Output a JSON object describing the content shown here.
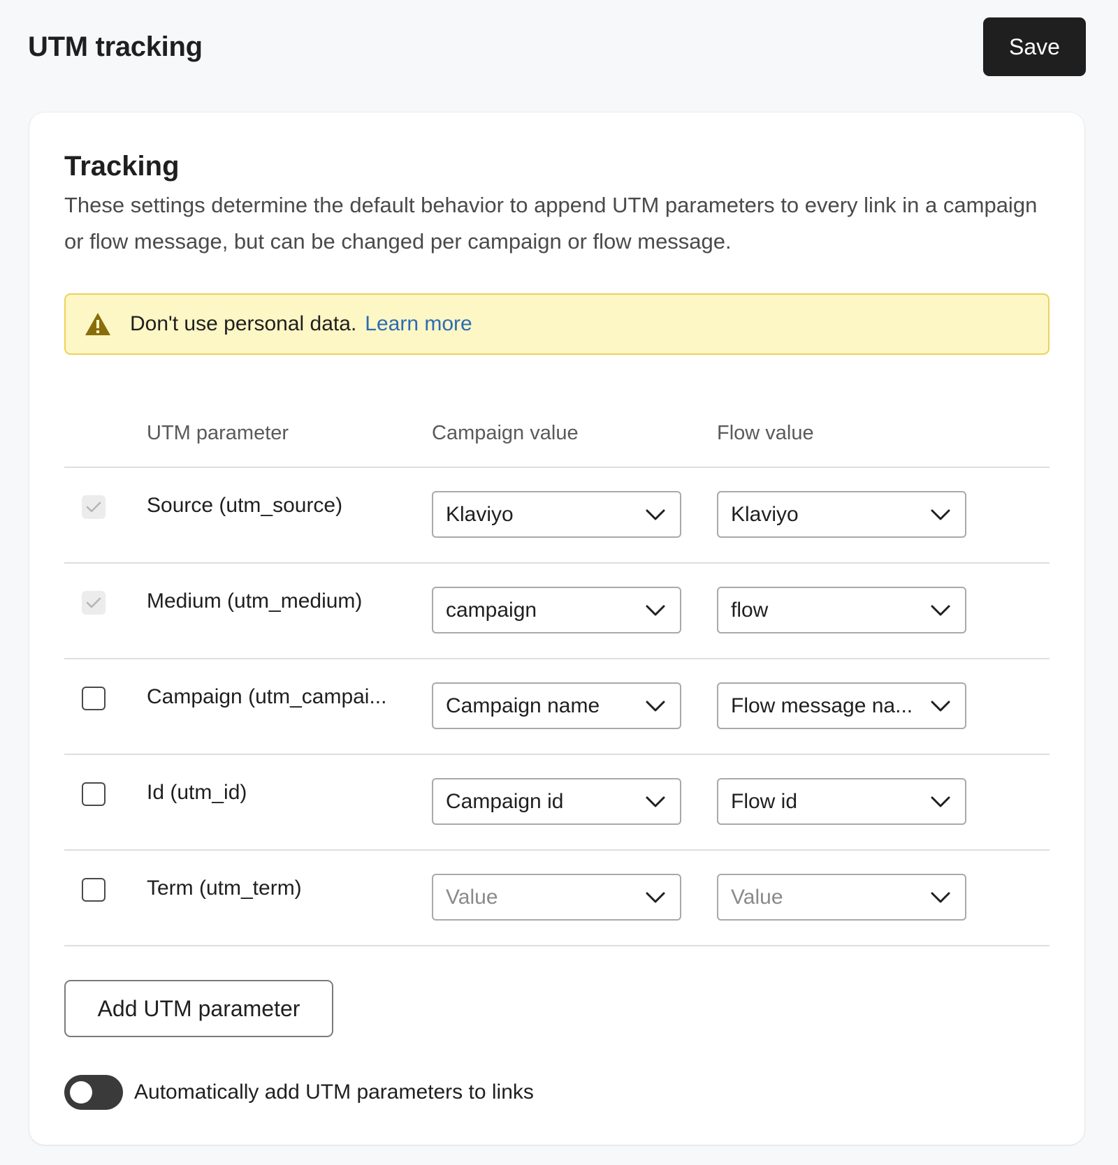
{
  "header": {
    "title": "UTM tracking",
    "save_label": "Save"
  },
  "tracking": {
    "title": "Tracking",
    "description": "These settings determine the default behavior to append UTM parameters to every link in a campaign or flow message, but can be changed per campaign or flow message.",
    "alert": {
      "icon": "warning-icon",
      "text": "Don't use personal data.",
      "link": "Learn more"
    }
  },
  "table": {
    "columns": [
      "UTM parameter",
      "Campaign value",
      "Flow value"
    ],
    "rows": [
      {
        "label": "Source (utm_source)",
        "checked": true,
        "disabled": true,
        "campaign_value": "Klaviyo",
        "flow_value": "Klaviyo",
        "placeholder": false
      },
      {
        "label": "Medium (utm_medium)",
        "checked": true,
        "disabled": true,
        "campaign_value": "campaign",
        "flow_value": "flow",
        "placeholder": false
      },
      {
        "label": "Campaign (utm_campai...",
        "checked": false,
        "disabled": false,
        "campaign_value": "Campaign name",
        "flow_value": "Flow message na...",
        "placeholder": false
      },
      {
        "label": "Id (utm_id)",
        "checked": false,
        "disabled": false,
        "campaign_value": "Campaign id",
        "flow_value": "Flow id",
        "placeholder": false
      },
      {
        "label": "Term (utm_term)",
        "checked": false,
        "disabled": false,
        "campaign_value": "Value",
        "flow_value": "Value",
        "placeholder": true
      }
    ]
  },
  "add_button_label": "Add UTM parameter",
  "auto_toggle": {
    "label": "Automatically add UTM parameters to links",
    "on": false
  },
  "colors": {
    "primary_button": "#1f1f1f",
    "alert_bg": "#fdf6c5",
    "alert_border": "#ecd259",
    "link": "#2b6cb5"
  }
}
